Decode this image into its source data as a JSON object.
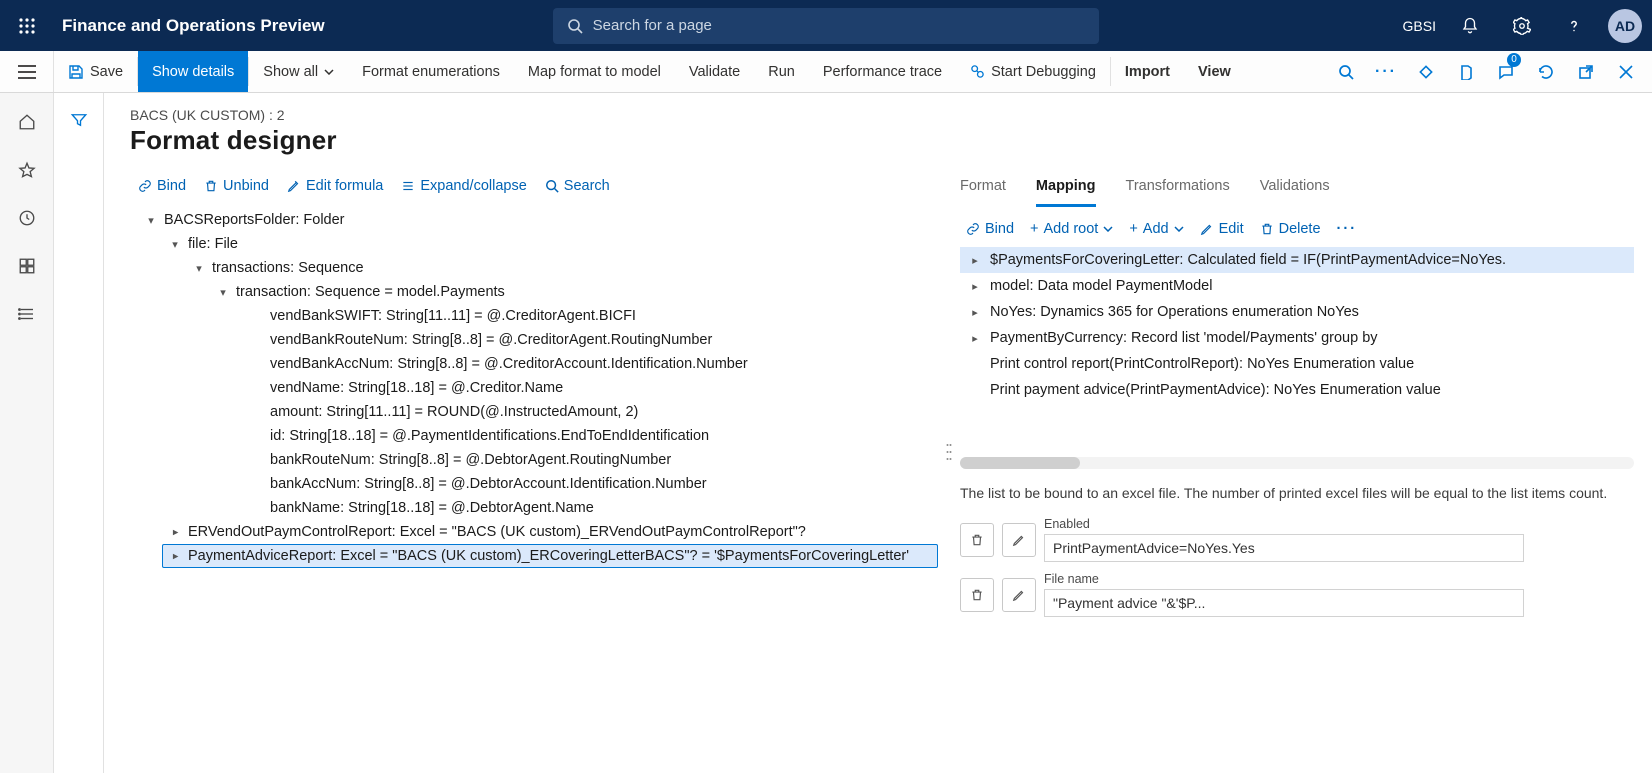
{
  "topbar": {
    "app_title": "Finance and Operations Preview",
    "search_placeholder": "Search for a page",
    "org_code": "GBSI",
    "avatar_initials": "AD",
    "message_badge": "0"
  },
  "cmdbar": {
    "save": "Save",
    "show_details": "Show details",
    "show_all": "Show all",
    "format_enum": "Format enumerations",
    "map_format": "Map format to model",
    "validate": "Validate",
    "run": "Run",
    "perf_trace": "Performance trace",
    "start_debug": "Start Debugging",
    "import": "Import",
    "view": "View"
  },
  "page": {
    "breadcrumb": "BACS (UK CUSTOM) : 2",
    "title": "Format designer"
  },
  "left_actions": {
    "bind": "Bind",
    "unbind": "Unbind",
    "edit_formula": "Edit formula",
    "expand": "Expand/collapse",
    "search": "Search"
  },
  "tree": {
    "n0": "BACSReportsFolder: Folder",
    "n1": "file: File",
    "n2": "transactions: Sequence",
    "n3": "transaction: Sequence = model.Payments",
    "leaves": [
      "vendBankSWIFT: String[11..11] = @.CreditorAgent.BICFI",
      "vendBankRouteNum: String[8..8] = @.CreditorAgent.RoutingNumber",
      "vendBankAccNum: String[8..8] = @.CreditorAccount.Identification.Number",
      "vendName: String[18..18] = @.Creditor.Name",
      "amount: String[11..11] = ROUND(@.InstructedAmount, 2)",
      "id: String[18..18] = @.PaymentIdentifications.EndToEndIdentification",
      "bankRouteNum: String[8..8] = @.DebtorAgent.RoutingNumber",
      "bankAccNum: String[8..8] = @.DebtorAccount.Identification.Number",
      "bankName: String[18..18] = @.DebtorAgent.Name"
    ],
    "n4": "ERVendOutPaymControlReport: Excel = \"BACS (UK custom)_ERVendOutPaymControlReport\"?",
    "n5": "PaymentAdviceReport: Excel = \"BACS (UK custom)_ERCoveringLetterBACS\"? = '$PaymentsForCoveringLetter'"
  },
  "tabs": {
    "format": "Format",
    "mapping": "Mapping",
    "transformations": "Transformations",
    "validations": "Validations"
  },
  "right_actions": {
    "bind": "Bind",
    "add_root": "Add root",
    "add": "Add",
    "edit": "Edit",
    "delete": "Delete"
  },
  "datasources": [
    "$PaymentsForCoveringLetter: Calculated field = IF(PrintPaymentAdvice=NoYes.",
    "model: Data model PaymentModel",
    "NoYes: Dynamics 365 for Operations enumeration NoYes",
    "PaymentByCurrency: Record list 'model/Payments' group by",
    "Print control report(PrintControlReport): NoYes Enumeration value",
    "Print payment advice(PrintPaymentAdvice): NoYes Enumeration value"
  ],
  "description": "The list to be bound to an excel file. The number of printed excel files will be equal to the list items count.",
  "props": {
    "enabled_label": "Enabled",
    "enabled_value": "PrintPaymentAdvice=NoYes.Yes",
    "filename_label": "File name",
    "filename_value": "\"Payment advice \"&'$P..."
  }
}
